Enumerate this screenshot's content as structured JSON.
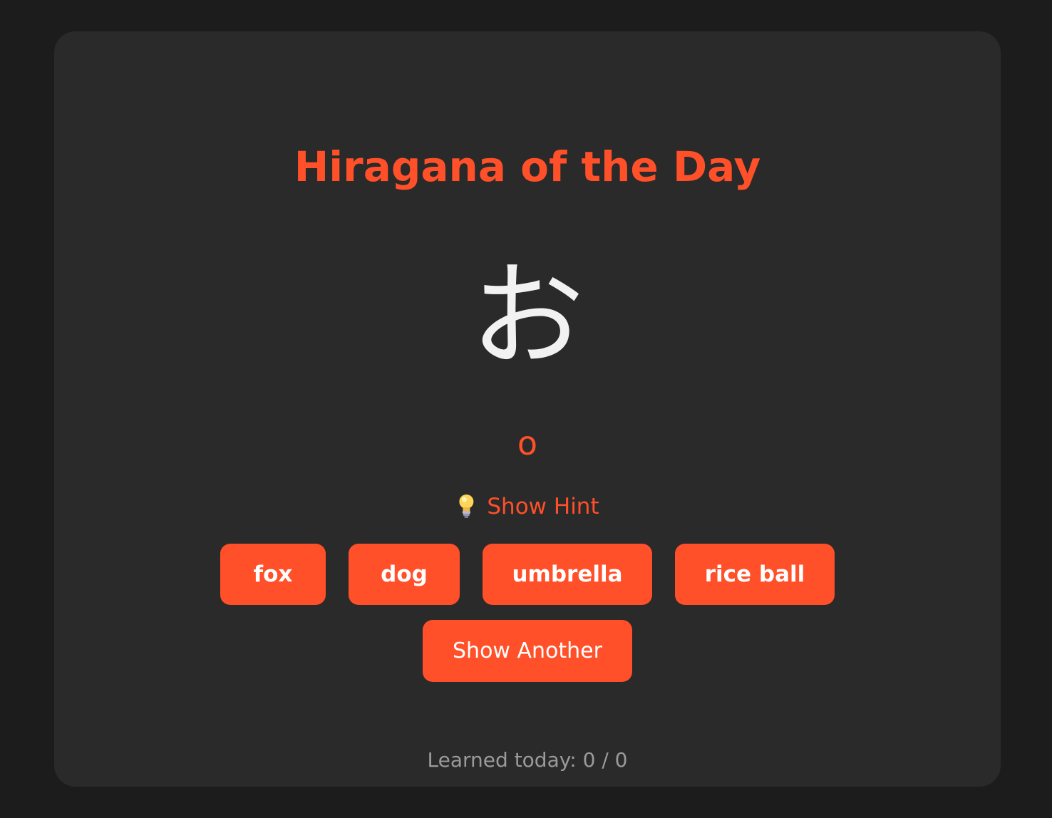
{
  "card": {
    "title": "Hiragana of the Day",
    "character": "お",
    "romaji": "o",
    "hint": {
      "icon": "lightbulb-icon",
      "label": "Show Hint"
    },
    "options": [
      {
        "label": "fox"
      },
      {
        "label": "dog"
      },
      {
        "label": "umbrella"
      },
      {
        "label": "rice ball"
      }
    ],
    "next_button": "Show Another",
    "progress": "Learned today: 0 / 0"
  },
  "colors": {
    "page_background": "#1c1c1c",
    "card_background": "#2a2a2a",
    "accent": "#ff5029",
    "character": "#f2f2f2",
    "muted_text": "#9a9a9a",
    "button_text": "#ffffff"
  }
}
